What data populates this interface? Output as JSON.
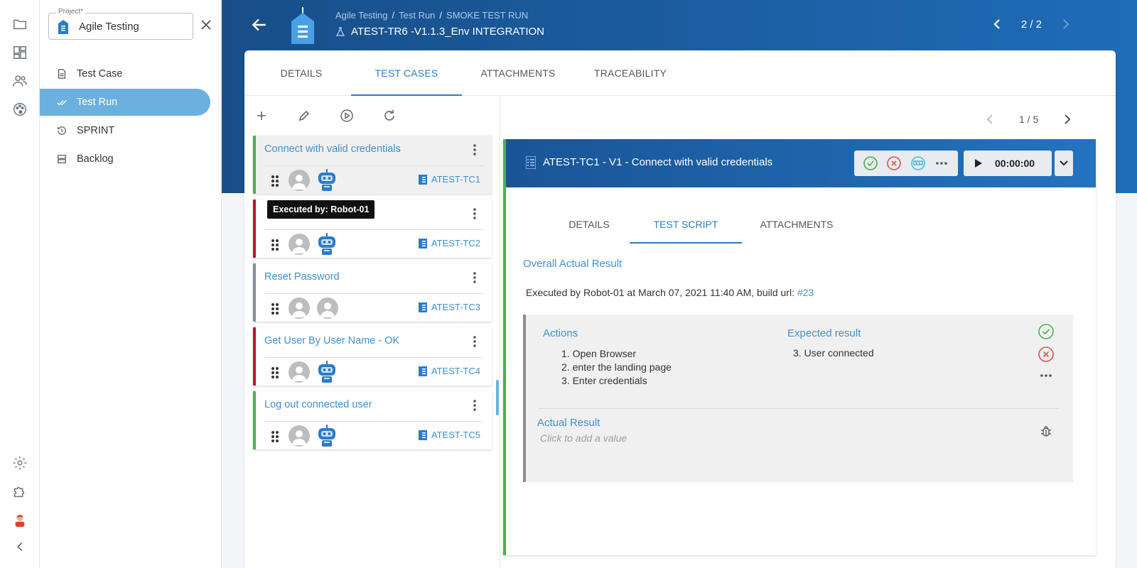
{
  "sidebar": {
    "project_label": "Project*",
    "project_value": "Agile Testing",
    "items": [
      {
        "label": "Test Case",
        "icon": "document-icon"
      },
      {
        "label": "Test Run",
        "icon": "double-check-icon"
      },
      {
        "label": "SPRINT",
        "icon": "history-icon"
      },
      {
        "label": "Backlog",
        "icon": "stack-icon"
      }
    ]
  },
  "header": {
    "breadcrumb": [
      "Agile Testing",
      "Test Run",
      "SMOKE TEST RUN"
    ],
    "run_title": "ATEST-TR6 -V1.1.3_Env INTEGRATION",
    "pager": "2 / 2"
  },
  "tabs": [
    "DETAILS",
    "TEST CASES",
    "ATTACHMENTS",
    "TRACEABILITY"
  ],
  "test_cases": [
    {
      "title": "Connect with valid credentials",
      "id": "ATEST-TC1",
      "status": "passed",
      "robot": true
    },
    {
      "title": "",
      "id": "ATEST-TC2",
      "status": "failed",
      "robot": true
    },
    {
      "title": "Reset Password",
      "id": "ATEST-TC3",
      "status": "not-run",
      "robot": false
    },
    {
      "title": "Get User By User Name - OK",
      "id": "ATEST-TC4",
      "status": "failed",
      "robot": true
    },
    {
      "title": "Log out connected user",
      "id": "ATEST-TC5",
      "status": "passed",
      "robot": true
    }
  ],
  "tooltip": "Executed by: Robot-01",
  "detail": {
    "pager": "1 / 5",
    "title": "ATEST-TC1 - V1 - Connect with valid credentials",
    "timer": "00:00:00",
    "subtabs": [
      "DETAILS",
      "TEST SCRIPT",
      "ATTACHMENTS"
    ],
    "overall_label": "Overall Actual Result",
    "executed_text": "Executed by Robot-01 at March 07, 2021 11:40 AM, build url: ",
    "build_link": "#23",
    "actions_label": "Actions",
    "expected_label": "Expected result",
    "actions": [
      "1. Open Browser",
      "2. enter the landing page",
      "3. Enter credentials"
    ],
    "expected": "3. User connected",
    "actual_label": "Actual Result",
    "actual_placeholder": "Click to add a value"
  },
  "colors": {
    "passed": "#4cb050",
    "failed": "#c8102e",
    "not_run": "#8a8f96",
    "accent": "#2b7cc9",
    "header": "#1a5596"
  }
}
